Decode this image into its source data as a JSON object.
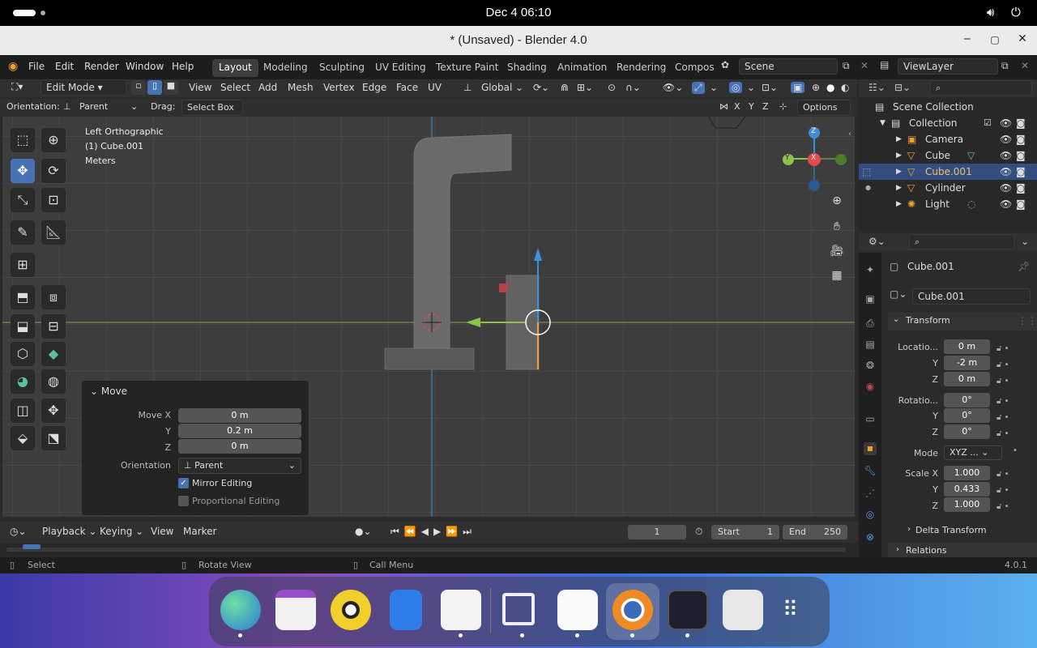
{
  "system": {
    "clock": "Dec 4  06:10"
  },
  "window": {
    "title": "* (Unsaved) - Blender 4.0",
    "minimize": "‒",
    "maximize": "▢",
    "close": "✕"
  },
  "menu": {
    "items": [
      "File",
      "Edit",
      "Render",
      "Window",
      "Help"
    ],
    "workspaces": [
      "Layout",
      "Modeling",
      "Sculpting",
      "UV Editing",
      "Texture Paint",
      "Shading",
      "Animation",
      "Rendering",
      "Compos"
    ],
    "active_workspace": "Layout",
    "scene": "Scene",
    "view_layer": "ViewLayer"
  },
  "viewport_header": {
    "mode": "Edit Mode",
    "items": [
      "View",
      "Select",
      "Add",
      "Mesh",
      "Vertex",
      "Edge",
      "Face",
      "UV"
    ],
    "transform_orientation": "Global",
    "orientation_label": "Orientation:",
    "orientation_value": "Parent",
    "drag_label": "Drag:",
    "drag_value": "Select Box",
    "options": "Options",
    "axes": [
      "X",
      "Y",
      "Z"
    ]
  },
  "overlay_text": {
    "view": "Left Orthographic",
    "object": "(1) Cube.001",
    "units": "Meters"
  },
  "gizmo": {
    "x": "X",
    "y": "Y",
    "z": "Z"
  },
  "move_panel": {
    "title": "Move",
    "move_x_label": "Move X",
    "move_x": "0 m",
    "y_label": "Y",
    "y": "0.2 m",
    "z_label": "Z",
    "z": "0 m",
    "orientation_label": "Orientation",
    "orientation": "Parent",
    "mirror_editing": "Mirror Editing",
    "mirror_checked": true,
    "proportional_editing": "Proportional Editing",
    "proportional_checked": false
  },
  "outliner": {
    "root": "Scene Collection",
    "collection": "Collection",
    "items": [
      "Camera",
      "Cube",
      "Cube.001",
      "Cylinder",
      "Light"
    ],
    "selected": "Cube.001"
  },
  "properties": {
    "object_name": "Cube.001",
    "data_name": "Cube.001",
    "section": "Transform",
    "location_label": "Locatio...",
    "location": [
      "0 m",
      "-2 m",
      "0 m"
    ],
    "rotation_label": "Rotatio...",
    "rotation": [
      "0°",
      "0°",
      "0°"
    ],
    "mode_label": "Mode",
    "mode": "XYZ ...",
    "scale_label": "Scale X",
    "scale": [
      "1.000",
      "0.433",
      "1.000"
    ],
    "axis_y": "Y",
    "axis_z": "Z",
    "delta": "Delta Transform",
    "relations": "Relations"
  },
  "timeline": {
    "items": [
      "Playback",
      "Keying",
      "View",
      "Marker"
    ],
    "current_frame": "1",
    "start_label": "Start",
    "start": "1",
    "end_label": "End",
    "end": "250"
  },
  "status": {
    "select": "Select",
    "rotate": "Rotate View",
    "menu": "Call Menu",
    "version": "4.0.1"
  },
  "colors": {
    "accent": "#4772b3",
    "x_axis": "#e5484d",
    "y_axis": "#8bc34a",
    "z_axis": "#3f8ed8",
    "orange": "#f0a030"
  }
}
